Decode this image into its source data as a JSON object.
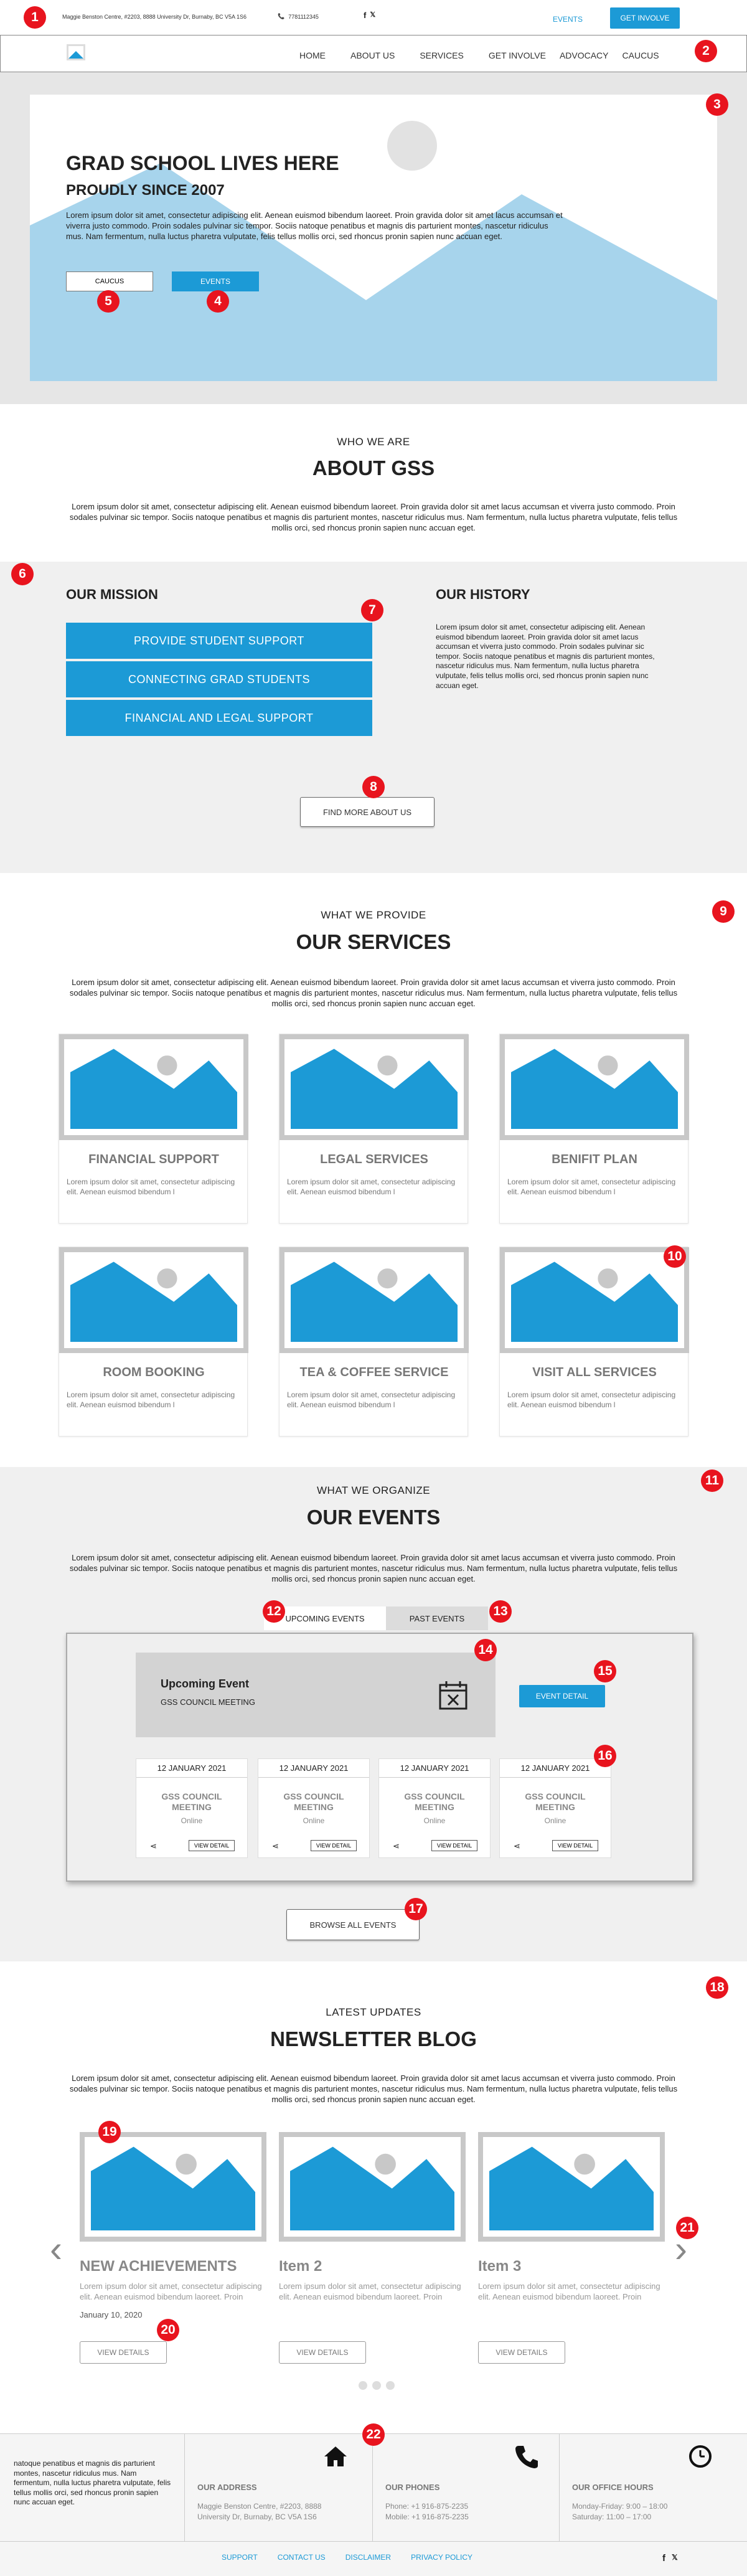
{
  "topbar": {
    "address": "Maggie Benston Centre, #2203, 8888 University Dr, Burnaby, BC V5A 1S6",
    "phone": "7781112345",
    "social": [
      "f",
      "𝕏"
    ],
    "events_link": "EVENTS",
    "get_involved": "GET INVOLVE"
  },
  "nav": {
    "items": [
      "HOME",
      "ABOUT US",
      "SERVICES",
      "GET INVOLVE",
      "ADVOCACY",
      "CAUCUS"
    ]
  },
  "hero": {
    "title": "GRAD SCHOOL LIVES HERE",
    "subtitle": "PROUDLY SINCE 2007",
    "text": "Lorem ipsum dolor sit amet, consectetur adipiscing elit. Aenean euismod bibendum laoreet. Proin gravida dolor sit amet lacus accumsan et viverra justo commodo. Proin sodales pulvinar sic tempor. Sociis natoque penatibus et magnis dis parturient montes, nascetur ridiculus mus. Nam fermentum, nulla luctus pharetra vulputate, felis tellus mollis orci, sed rhoncus pronin sapien nunc accuan eget.",
    "caucus_btn": "CAUCUS",
    "events_btn": "EVENTS"
  },
  "about": {
    "kicker": "WHO WE ARE",
    "title": "ABOUT GSS",
    "text": "Lorem ipsum dolor sit amet, consectetur adipiscing elit. Aenean euismod bibendum laoreet. Proin gravida dolor sit amet lacus accumsan et viverra justo commodo. Proin sodales pulvinar sic tempor. Sociis natoque penatibus et magnis dis parturient montes, nascetur ridiculus mus. Nam fermentum, nulla luctus pharetra vulputate, felis tellus mollis orci, sed rhoncus pronin sapien nunc accuan eget."
  },
  "mission": {
    "title": "OUR MISSION",
    "buttons": [
      "PROVIDE STUDENT SUPPORT",
      "CONNECTING GRAD STUDENTS",
      "FINANCIAL AND LEGAL SUPPORT"
    ],
    "history_title": "OUR HISTORY",
    "history_text": "Lorem ipsum dolor sit amet, consectetur adipiscing elit. Aenean euismod bibendum laoreet. Proin gravida dolor sit amet lacus accumsan et viverra justo commodo. Proin sodales pulvinar sic tempor. Sociis natoque penatibus et magnis dis parturient montes, nascetur ridiculus mus. Nam fermentum, nulla luctus pharetra vulputate, felis tellus mollis orci, sed rhoncus pronin sapien nunc accuan eget.",
    "find_more": "FIND MORE ABOUT US"
  },
  "services": {
    "kicker": "WHAT WE PROVIDE",
    "title": "OUR SERVICES",
    "text": "Lorem ipsum dolor sit amet, consectetur adipiscing elit. Aenean euismod bibendum laoreet. Proin gravida dolor sit amet lacus accumsan et viverra justo commodo. Proin sodales pulvinar sic tempor. Sociis natoque penatibus et magnis dis parturient montes, nascetur ridiculus mus. Nam fermentum, nulla luctus pharetra vulputate, felis tellus mollis orci, sed rhoncus pronin sapien nunc accuan eget.",
    "cards": [
      {
        "title": "FINANCIAL SUPPORT",
        "text": "Lorem ipsum dolor sit amet, consectetur adipiscing elit. Aenean euismod bibendum l"
      },
      {
        "title": "LEGAL SERVICES",
        "text": "Lorem ipsum dolor sit amet, consectetur adipiscing elit. Aenean euismod bibendum l"
      },
      {
        "title": "BENIFIT PLAN",
        "text": "Lorem ipsum dolor sit amet, consectetur adipiscing elit. Aenean euismod bibendum l"
      },
      {
        "title": "ROOM BOOKING",
        "text": "Lorem ipsum dolor sit amet, consectetur adipiscing elit. Aenean euismod bibendum l"
      },
      {
        "title": "TEA & COFFEE SERVICE",
        "text": "Lorem ipsum dolor sit amet, consectetur adipiscing elit. Aenean euismod bibendum l"
      },
      {
        "title": "VISIT ALL SERVICES",
        "text": "Lorem ipsum dolor sit amet, consectetur adipiscing elit. Aenean euismod bibendum l"
      }
    ]
  },
  "events": {
    "kicker": "WHAT WE ORGANIZE",
    "title": "OUR EVENTS",
    "text": "Lorem ipsum dolor sit amet, consectetur adipiscing elit. Aenean euismod bibendum laoreet. Proin gravida dolor sit amet lacus accumsan et viverra justo commodo. Proin sodales pulvinar sic tempor. Sociis natoque penatibus et magnis dis parturient montes, nascetur ridiculus mus. Nam fermentum, nulla luctus pharetra vulputate, felis tellus mollis orci, sed rhoncus pronin sapien nunc accuan eget.",
    "tab_upcoming": "UPCOMING EVENTS",
    "tab_past": "PAST EVENTS",
    "upcoming_title": "Upcoming Event",
    "upcoming_name": "GSS COUNCIL MEETING",
    "event_detail": "EVENT DETAIL",
    "items": [
      {
        "date": "12 JANUARY 2021",
        "name": "GSS COUNCIL MEETING",
        "mode": "Online",
        "btn": "VIEW DETAIL"
      },
      {
        "date": "12 JANUARY 2021",
        "name": "GSS COUNCIL MEETING",
        "mode": "Online",
        "btn": "VIEW DETAIL"
      },
      {
        "date": "12 JANUARY 2021",
        "name": "GSS COUNCIL MEETING",
        "mode": "Online",
        "btn": "VIEW DETAIL"
      },
      {
        "date": "12 JANUARY 2021",
        "name": "GSS COUNCIL MEETING",
        "mode": "Online",
        "btn": "VIEW DETAIL"
      }
    ],
    "browse_all": "BROWSE ALL EVENTS"
  },
  "blog": {
    "kicker": "LATEST UPDATES",
    "title": "NEWSLETTER BLOG",
    "text": "Lorem ipsum dolor sit amet, consectetur adipiscing elit. Aenean euismod bibendum laoreet. Proin gravida dolor sit amet lacus accumsan et viverra justo commodo. Proin sodales pulvinar sic tempor. Sociis natoque penatibus et magnis dis parturient montes, nascetur ridiculus mus. Nam fermentum, nulla luctus pharetra vulputate, felis tellus mollis orci, sed rhoncus pronin sapien nunc accuan eget.",
    "items": [
      {
        "title": "NEW ACHIEVEMENTS",
        "text": "Lorem ipsum dolor sit amet, consectetur adipiscing elit. Aenean euismod bibendum laoreet. Proin",
        "date": "January 10, 2020",
        "btn": "VIEW DETAILS"
      },
      {
        "title": "Item 2",
        "text": "Lorem ipsum dolor sit amet, consectetur adipiscing elit. Aenean euismod bibendum laoreet. Proin",
        "btn": "VIEW DETAILS"
      },
      {
        "title": "Item 3",
        "text": "Lorem ipsum dolor sit amet, consectetur adipiscing elit. Aenean euismod bibendum laoreet. Proin",
        "btn": "VIEW DETAILS"
      }
    ],
    "prev": "‹",
    "next": "›"
  },
  "footer": {
    "intro": "natoque penatibus et magnis dis parturient montes, nascetur ridiculus mus. Nam fermentum, nulla luctus pharetra vulputate, felis tellus mollis orci, sed rhoncus pronin sapien nunc accuan eget.",
    "address_title": "OUR ADDRESS",
    "address": "Maggie Benston Centre, #2203, 8888 University Dr, Burnaby, BC V5A 1S6",
    "phones_title": "OUR PHONES",
    "phone1": "Phone: +1 916-875-2235",
    "phone2": "Mobile: +1 916-875-2235",
    "hours_title": "OUR OFFICE HOURS",
    "hours1": "Monday-Friday: 9:00 – 18:00",
    "hours2": "Saturday: 11:00 – 17:00",
    "links": [
      "SUPPORT",
      "CONTACT US",
      "DISCLAIMER",
      "PRIVACY POLICY"
    ]
  },
  "markers": [
    "1",
    "2",
    "3",
    "4",
    "5",
    "6",
    "7",
    "8",
    "9",
    "10",
    "11",
    "12",
    "13",
    "14",
    "15",
    "16",
    "17",
    "18",
    "19",
    "20",
    "21",
    "22"
  ],
  "colors": {
    "accent": "#1c9ad6",
    "marker": "#e8141e",
    "hero_mountain": "#a7d4ec"
  }
}
